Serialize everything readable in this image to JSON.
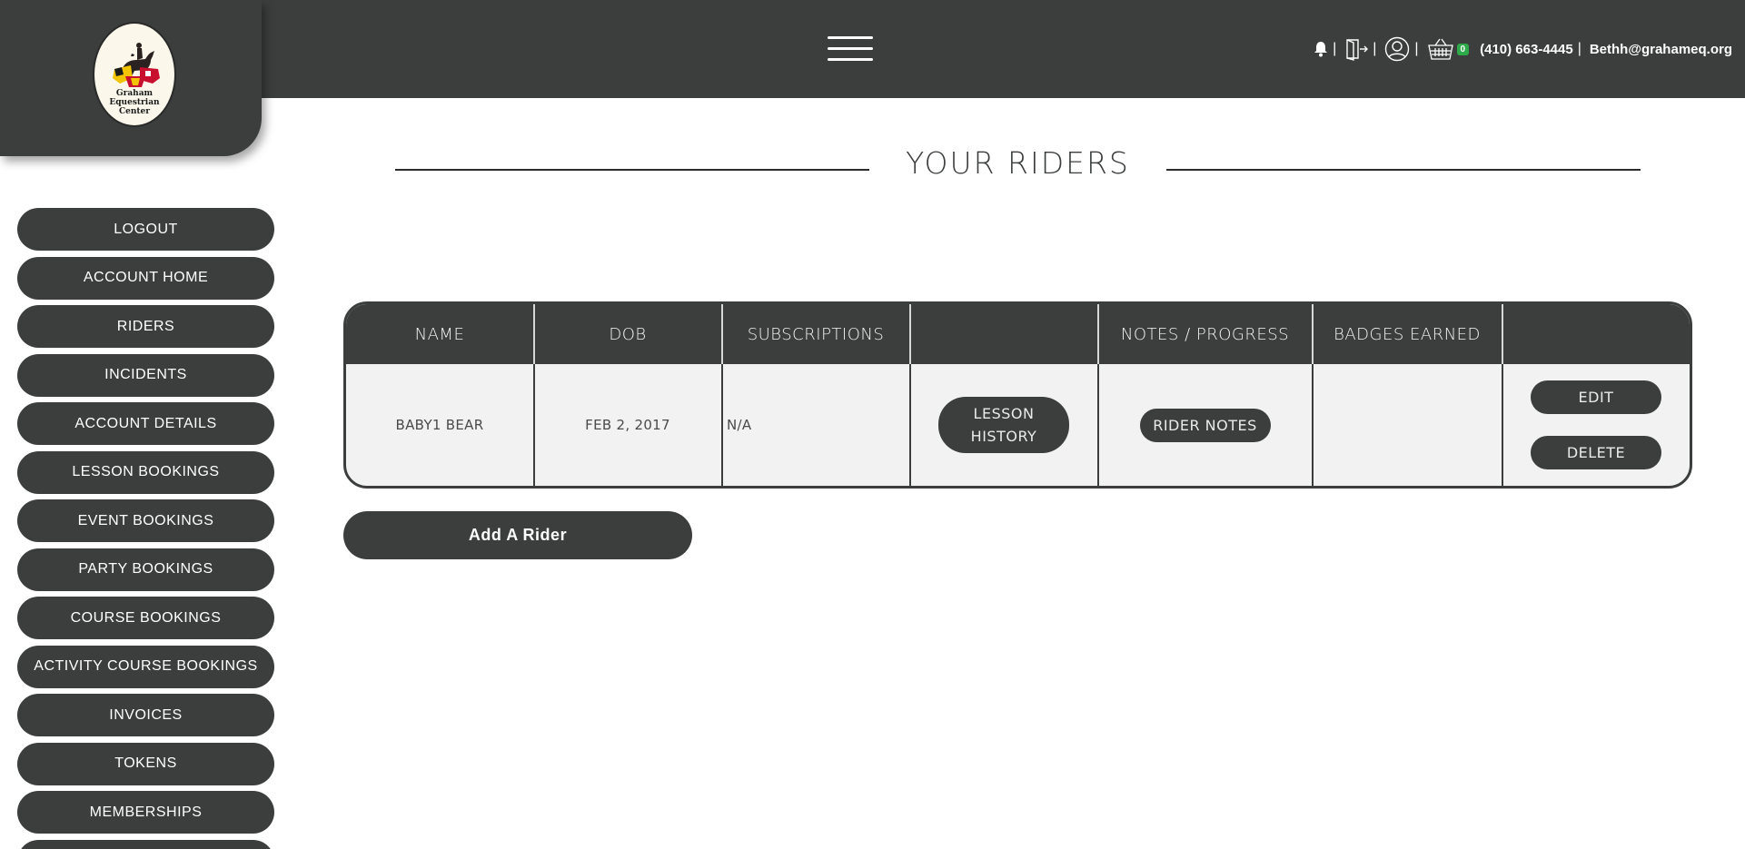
{
  "logo": {
    "lines": [
      "Graham",
      "Equestrian",
      "Center"
    ]
  },
  "header": {
    "cart_count": "0",
    "separator": "|",
    "phone": "(410) 663-4445",
    "email": "Bethh@grahameq.org"
  },
  "sidebar": {
    "items": [
      {
        "label": "LOGOUT"
      },
      {
        "label": "ACCOUNT HOME"
      },
      {
        "label": "RIDERS"
      },
      {
        "label": "INCIDENTS"
      },
      {
        "label": "ACCOUNT DETAILS"
      },
      {
        "label": "LESSON BOOKINGS"
      },
      {
        "label": "EVENT BOOKINGS"
      },
      {
        "label": "PARTY BOOKINGS"
      },
      {
        "label": "COURSE BOOKINGS"
      },
      {
        "label": "ACTIVITY COURSE BOOKINGS"
      },
      {
        "label": "INVOICES"
      },
      {
        "label": "TOKENS"
      },
      {
        "label": "MEMBERSHIPS"
      },
      {
        "label": ""
      }
    ]
  },
  "main": {
    "title": "YOUR RIDERS",
    "table": {
      "headers": [
        "NAME",
        "DOB",
        "SUBSCRIPTIONS",
        "",
        "NOTES / PROGRESS",
        "BADGES EARNED",
        ""
      ],
      "rows": [
        {
          "name": "BABY1 BEAR",
          "dob": "FEB 2, 2017",
          "subscriptions": "N/A",
          "lesson_history_label_1": "LESSON",
          "lesson_history_label_2": "HISTORY",
          "rider_notes_label": "RIDER NOTES",
          "badges": "",
          "edit_label": "EDIT",
          "delete_label": "DELETE"
        }
      ]
    },
    "add_rider_label": "Add A Rider"
  },
  "colors": {
    "primary_dark": "#3b3e3d",
    "row_bg": "#f2f2f2",
    "cart_badge": "#2eaa4a",
    "background": "#ffffff"
  }
}
